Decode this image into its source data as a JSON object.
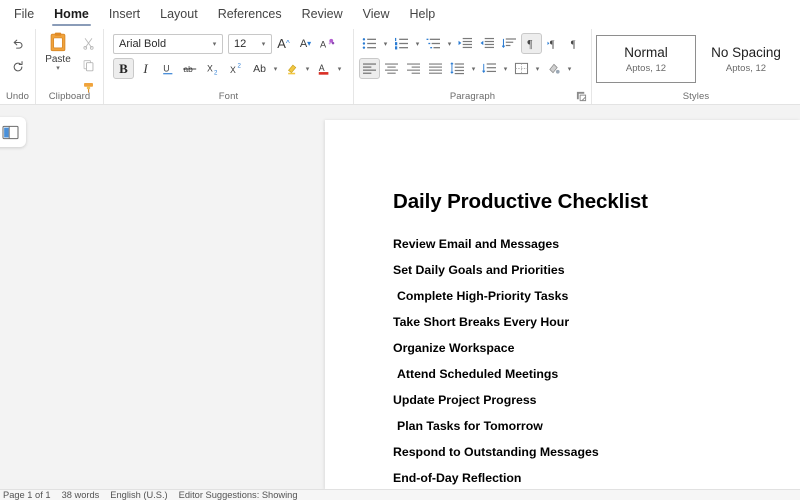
{
  "tabs": [
    {
      "label": "File",
      "active": false
    },
    {
      "label": "Home",
      "active": true
    },
    {
      "label": "Insert",
      "active": false
    },
    {
      "label": "Layout",
      "active": false
    },
    {
      "label": "References",
      "active": false
    },
    {
      "label": "Review",
      "active": false
    },
    {
      "label": "View",
      "active": false
    },
    {
      "label": "Help",
      "active": false
    }
  ],
  "ribbon": {
    "undo_group": {
      "label": "Undo",
      "undo_icon": "undo-arrow-icon",
      "redo_icon": "redo-arrow-icon"
    },
    "clipboard_group": {
      "label": "Clipboard",
      "paste_label": "Paste",
      "cut_icon": "scissors-icon",
      "copy_icon": "copy-icon",
      "format_painter_icon": "format-painter-icon"
    },
    "font_group": {
      "label": "Font",
      "font_name": "Arial Bold",
      "font_size": "12",
      "grow_font": "A",
      "shrink_font": "A",
      "clear_formatting": "Ab",
      "bold": "B",
      "italic": "I",
      "underline": "U",
      "strikethrough": "ab",
      "subscript": "X",
      "superscript": "X",
      "text_case": "Ab",
      "highlight_icon": "highlighter-icon",
      "font_color_icon": "font-color-icon",
      "accent_highlight": "#f2c744",
      "accent_font_color": "#d93025"
    },
    "paragraph_group": {
      "label": "Paragraph",
      "bullets_icon": "bullet-list-icon",
      "numbering_icon": "numbered-list-icon",
      "multilevel_icon": "multilevel-list-icon",
      "increase_indent_icon": "increase-indent-icon",
      "decrease_indent_icon": "decrease-indent-icon",
      "sort_icon": "sort-icon",
      "ltr_icon": "left-to-right-icon",
      "rtl_icon": "right-to-left-icon",
      "show_marks_icon": "paragraph-mark-icon",
      "align_left_icon": "align-left-icon",
      "align_center_icon": "align-center-icon",
      "align_right_icon": "align-right-icon",
      "justify_icon": "justify-icon",
      "line_spacing_icon": "line-spacing-icon",
      "paragraph_spacing_icon": "paragraph-spacing-icon",
      "borders_icon": "borders-icon",
      "shading_icon": "shading-icon",
      "dialog_launcher_icon": "dialog-launcher-icon",
      "accent_blue": "#2b7cd3"
    },
    "styles_group": {
      "label": "Styles",
      "items": [
        {
          "name": "Normal",
          "detail": "Aptos, 12",
          "selected": true
        },
        {
          "name": "No Spacing",
          "detail": "Aptos, 12",
          "selected": false
        }
      ]
    }
  },
  "workspace": {
    "nav_toggle_icon": "navigation-pane-icon"
  },
  "document": {
    "title": "Daily Productive Checklist",
    "lines": [
      {
        "text": "Review Email and Messages",
        "indent": false
      },
      {
        "text": "Set Daily Goals and Priorities",
        "indent": false
      },
      {
        "text": "Complete High-Priority Tasks",
        "indent": true
      },
      {
        "text": "Take Short Breaks Every Hour",
        "indent": false
      },
      {
        "text": "Organize Workspace",
        "indent": false
      },
      {
        "text": "Attend Scheduled Meetings",
        "indent": true
      },
      {
        "text": "Update Project Progress",
        "indent": false
      },
      {
        "text": "Plan Tasks for Tomorrow",
        "indent": true
      },
      {
        "text": "Respond to Outstanding Messages",
        "indent": false
      },
      {
        "text": "End-of-Day Reflection",
        "indent": false
      }
    ]
  },
  "statusbar": {
    "page": "Page 1 of 1",
    "words": "38 words",
    "language": "English (U.S.)",
    "editor": "Editor Suggestions: Showing"
  }
}
